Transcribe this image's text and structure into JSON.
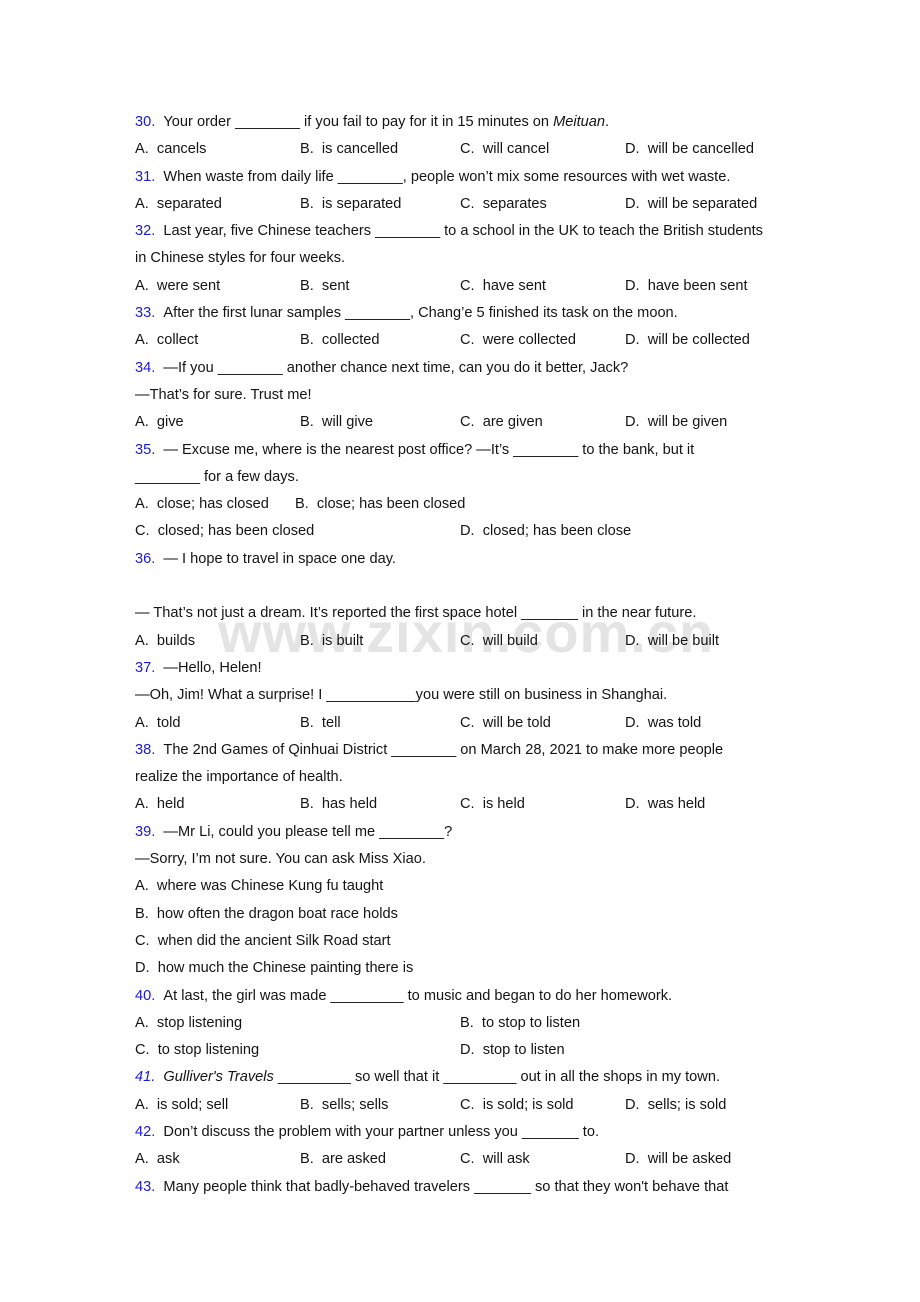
{
  "page": {
    "watermark": "www.zixin.com.cn",
    "accent_blue": "#1a1ad6",
    "text_color": "#141414",
    "background": "#ffffff"
  },
  "questions": [
    {
      "num": "30.",
      "stem_lines": [
        {
          "pre": "Your order ________ if you fail to pay for it in 15 minutes on ",
          "ital": "Meituan",
          "post": "."
        }
      ],
      "options": {
        "A": "cancels",
        "B": "is cancelled",
        "C": "will cancel",
        "D": "will be cancelled"
      }
    },
    {
      "num": "31.",
      "stem_lines": [
        {
          "pre": "When waste from daily life ________, people won’t mix some resources with wet waste."
        }
      ],
      "options": {
        "A": "separated",
        "B": "is separated",
        "C": "separates",
        "D": "will be separated"
      }
    },
    {
      "num": "32.",
      "stem_lines": [
        {
          "pre": "Last year, five Chinese teachers ________ to a school in the UK to teach the British students"
        },
        {
          "pre": "in Chinese styles for four weeks.",
          "cont": true
        }
      ],
      "options": {
        "A": "were sent",
        "B": "sent",
        "C": "have sent",
        "D": "have been sent"
      }
    },
    {
      "num": "33.",
      "stem_lines": [
        {
          "pre": "After the first lunar samples ________, Chang’e 5 finished its task on the moon."
        }
      ],
      "options": {
        "A": "collect",
        "B": "collected",
        "C": "were collected",
        "D": "will be collected"
      }
    },
    {
      "num": "34.",
      "stem_lines": [
        {
          "pre": "—If you ________ another chance next time, can you do it better, Jack?"
        },
        {
          "pre": "—That’s for sure. Trust me!",
          "cont": true
        }
      ],
      "options": {
        "A": "give",
        "B": "will give",
        "C": "are given",
        "D": "will be given"
      }
    },
    {
      "num": "35.",
      "stem_lines": [
        {
          "pre": "— Excuse me, where is the nearest post office?  —It’s ________ to the bank, but it"
        },
        {
          "pre": "________ for a few days.",
          "cont": true
        }
      ],
      "options_wide": [
        {
          "a_letter": "A.",
          "a_text": "close; has closed",
          "b_letter": "B.",
          "b_text": "close; has been closed",
          "narrow": true
        },
        {
          "a_letter": "C.",
          "a_text": "closed; has been closed",
          "b_letter": "D.",
          "b_text": "closed; has been close",
          "narrow": false
        }
      ]
    },
    {
      "num": "36.",
      "stem_lines": [
        {
          "pre": "— I hope to travel in space one day."
        },
        {
          "blank": true
        },
        {
          "pre": "— That’s not just a dream. It’s reported the first space hotel _______ in the near future.",
          "cont": true
        }
      ],
      "options": {
        "A": "builds",
        "B": "is built",
        "C": "will build",
        "D": "will be built"
      }
    },
    {
      "num": "37.",
      "stem_lines": [
        {
          "pre": "—Hello, Helen!"
        },
        {
          "pre": "—Oh, Jim! What a surprise! I ___________you were still on business in Shanghai.",
          "cont": true
        }
      ],
      "options": {
        "A": "told",
        "B": "tell",
        "C": "will be told",
        "D": "was told"
      }
    },
    {
      "num": "38.",
      "stem_lines": [
        {
          "pre": "The 2nd Games of Qinhuai District ________ on March 28, 2021 to make more people"
        },
        {
          "pre": "realize the importance of health.",
          "cont": true
        }
      ],
      "options": {
        "A": "held",
        "B": "has held",
        "C": "is held",
        "D": "was held"
      }
    },
    {
      "num": "39.",
      "stem_lines": [
        {
          "pre": "—Mr Li, could you please tell me ________?"
        },
        {
          "pre": "—Sorry, I’m not sure. You can ask Miss Xiao.",
          "cont": true
        }
      ],
      "options_stacked": [
        {
          "letter": "A.",
          "text": "where was Chinese Kung fu taught"
        },
        {
          "letter": "B.",
          "text": "how often the dragon boat race holds"
        },
        {
          "letter": "C.",
          "text": "when did the ancient Silk Road start"
        },
        {
          "letter": "D.",
          "text": "how much the Chinese painting there is"
        }
      ]
    },
    {
      "num": "40.",
      "stem_lines": [
        {
          "pre": "At last, the girl was made _________ to music and began to do her homework."
        }
      ],
      "options_wide": [
        {
          "a_letter": "A.",
          "a_text": "stop listening",
          "b_letter": "B.",
          "b_text": "to stop to listen",
          "narrow": false
        },
        {
          "a_letter": "C.",
          "a_text": "to stop listening",
          "b_letter": "D.",
          "b_text": "stop to listen",
          "narrow": false
        }
      ]
    },
    {
      "num": "41.",
      "num_italic": true,
      "stem_lines": [
        {
          "ital_lead": "Gulliver's Travels",
          "post": " _________ so well that it _________ out in all the shops in my town."
        }
      ],
      "options": {
        "A": "is sold; sell",
        "B": "sells; sells",
        "C": "is sold; is sold",
        "D": "sells; is sold"
      }
    },
    {
      "num": "42.",
      "stem_lines": [
        {
          "pre": "Don’t discuss the problem with your partner unless you _______ to."
        }
      ],
      "options": {
        "A": "ask",
        "B": "are asked",
        "C": "will ask",
        "D": "will be asked"
      }
    },
    {
      "num": "43.",
      "stem_lines": [
        {
          "pre": "Many people think that badly-behaved travelers _______ so that they won't behave that"
        }
      ],
      "options": null
    }
  ]
}
